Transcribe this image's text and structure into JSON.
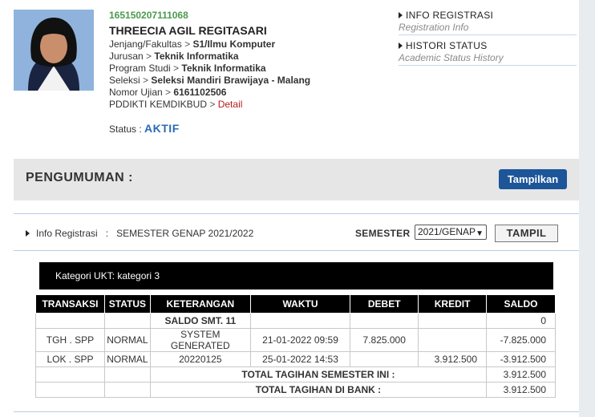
{
  "profile": {
    "nim": "165150207111068",
    "name": "THREECIA AGIL REGITASARI",
    "rows": [
      {
        "label": "Jenjang/Fakultas",
        "value": "S1/Ilmu Komputer"
      },
      {
        "label": "Jurusan",
        "value": "Teknik Informatika"
      },
      {
        "label": "Program Studi",
        "value": "Teknik Informatika"
      },
      {
        "label": "Seleksi",
        "value": "Seleksi Mandiri Brawijaya - Malang"
      },
      {
        "label": "Nomor Ujian",
        "value": "6161102506"
      }
    ],
    "pddikti_label": "PDDIKTI KEMDIKBUD",
    "pddikti_link": "Detail",
    "status_label": "Status :",
    "status_value": "AKTIF"
  },
  "menu": [
    {
      "title": "INFO REGISTRASI",
      "subtitle": "Registration Info"
    },
    {
      "title": "HISTORI STATUS",
      "subtitle": "Academic Status History"
    }
  ],
  "announcement": {
    "title": "PENGUMUMAN :",
    "button": "Tampilkan"
  },
  "infobar": {
    "label": "Info Registrasi",
    "colon": ":",
    "value": "SEMESTER GENAP 2021/2022",
    "semester_label": "SEMESTER",
    "semester_selected": "2021/GENAP",
    "button": "TAMPIL"
  },
  "ukt": "Kategori UKT: kategori 3",
  "table": {
    "headers": [
      "TRANSAKSI",
      "STATUS",
      "KETERANGAN",
      "WAKTU",
      "DEBET",
      "KREDIT",
      "SALDO"
    ],
    "saldo_label": "SALDO SMT. 11",
    "saldo_value": "0",
    "rows": [
      {
        "transaksi": "TGH . SPP",
        "status": "NORMAL",
        "keterangan": "SYSTEM GENERATED",
        "waktu": "21-01-2022 09:59",
        "debet": "7.825.000",
        "kredit": "",
        "saldo": "-7.825.000"
      },
      {
        "transaksi": "LOK . SPP",
        "status": "NORMAL",
        "keterangan": "20220125",
        "waktu": "25-01-2022 14:53",
        "debet": "",
        "kredit": "3.912.500",
        "saldo": "-3.912.500"
      }
    ],
    "total_semester_label": "TOTAL TAGIHAN SEMESTER INI :",
    "total_semester_value": "3.912.500",
    "total_bank_label": "TOTAL TAGIHAN DI BANK :",
    "total_bank_value": "3.912.500"
  },
  "colors": {
    "nim": "#4a9a4f",
    "status": "#2a6ab5",
    "link": "#b71c1c",
    "button": "#1d5599"
  }
}
